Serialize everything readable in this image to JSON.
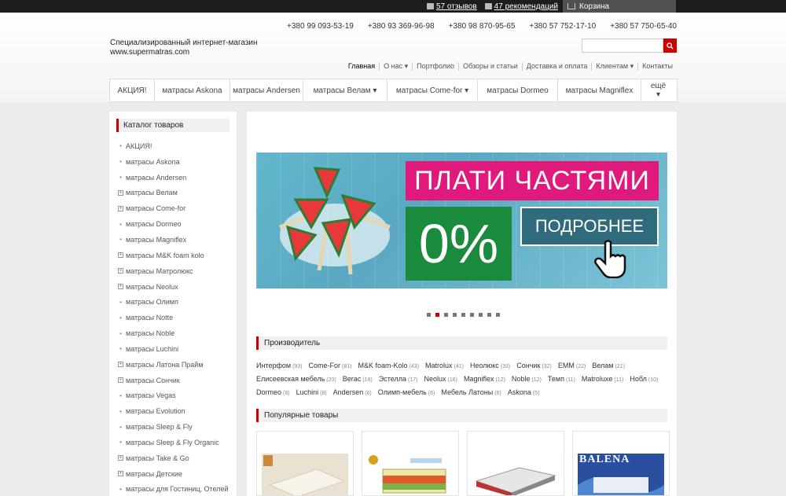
{
  "topbar": {
    "reviews": "57 отзывов",
    "recommendations": "47 рекомендаций",
    "cart": "Корзина"
  },
  "header": {
    "phones": [
      "+380 99 093-53-19",
      "+380 93 369-96-98",
      "+380 98 870-95-65",
      "+380 57 752-17-10",
      "+380 57 750-65-40"
    ],
    "tagline": "Специализированный интернет-магазин",
    "site": "www.supermatras.com",
    "search_placeholder": ""
  },
  "topnav": [
    "Главная",
    "О нас ▾",
    "Портфолио",
    "Обзоры и статьи",
    "Доставка и оплата",
    "Клиентам ▾",
    "Контакты"
  ],
  "mainmenu": [
    "АКЦИЯ!",
    "матрасы Askona",
    "матрасы Andersen",
    "матрасы Велам ▾",
    "матрасы Come-for ▾",
    "матрасы Dormeo",
    "матрасы Magniflex",
    "ещё",
    "▾"
  ],
  "sidebar": {
    "title": "Каталог товаров",
    "items": [
      {
        "label": "АКЦИЯ!",
        "plus": false
      },
      {
        "label": "матрасы Askona",
        "plus": false
      },
      {
        "label": "матрасы Andersen",
        "plus": false
      },
      {
        "label": "матрасы Велам",
        "plus": true
      },
      {
        "label": "матрасы Come-for",
        "plus": true
      },
      {
        "label": "матрасы Dormeo",
        "plus": false
      },
      {
        "label": "матрасы Magniflex",
        "plus": false
      },
      {
        "label": "матрасы M&K foam kolo",
        "plus": true
      },
      {
        "label": "матрасы Матролюкс",
        "plus": true
      },
      {
        "label": "матрасы Neolux",
        "plus": true
      },
      {
        "label": "матрасы Олимп",
        "plus": false
      },
      {
        "label": "матрасы Notte",
        "plus": false
      },
      {
        "label": "матрасы Noble",
        "plus": false
      },
      {
        "label": "матрасы Luchini",
        "plus": false
      },
      {
        "label": "матрасы Латона Прайм",
        "plus": true
      },
      {
        "label": "матрасы Сончик",
        "plus": true
      },
      {
        "label": "матрасы Vegas",
        "plus": false
      },
      {
        "label": "матрасы Evolution",
        "plus": false
      },
      {
        "label": "матрасы Sleep & Fly",
        "plus": false
      },
      {
        "label": "матрасы Sleep & Fly Organic",
        "plus": false
      },
      {
        "label": "матрасы Take & Go",
        "plus": true
      },
      {
        "label": "матрасы Детские",
        "plus": true
      },
      {
        "label": "матрасы для Гостиниц, Отелей",
        "plus": false
      }
    ]
  },
  "banner": {
    "headline": "ПЛАТИ ЧАСТЯМИ",
    "percent": "0%",
    "button": "ПОДРОБНЕЕ",
    "slides": 9,
    "active_slide": 2
  },
  "manufacturers": {
    "title": "Производитель",
    "rows": [
      [
        [
          "Интерфом",
          "(93)"
        ],
        [
          "Come-For",
          "(81)"
        ],
        [
          "M&K foam-Kolo",
          "(43)"
        ],
        [
          "Matrolux",
          "(41)"
        ],
        [
          "Неолюкс",
          "(33)"
        ],
        [
          "Сончик",
          "(32)"
        ],
        [
          "EMM",
          "(22)"
        ],
        [
          "Велам",
          "(21)"
        ]
      ],
      [
        [
          "Елисеевская мебель",
          "(20)"
        ],
        [
          "Вегас",
          "(18)"
        ],
        [
          "Эстелла",
          "(17)"
        ],
        [
          "Neolux",
          "(16)"
        ],
        [
          "Magniflex",
          "(12)"
        ],
        [
          "Noble",
          "(12)"
        ],
        [
          "Темп",
          "(11)"
        ],
        [
          "Matroluxe",
          "(11)"
        ],
        [
          "Нобл",
          "(10)"
        ]
      ],
      [
        [
          "Dormeo",
          "(8)"
        ],
        [
          "Luchini",
          "(8)"
        ],
        [
          "Andersen",
          "(6)"
        ],
        [
          "Олимп-мебель",
          "(6)"
        ],
        [
          "Мебель Латоны",
          "(6)"
        ],
        [
          "Askona",
          "(5)"
        ]
      ]
    ]
  },
  "popular": {
    "title": "Популярные товары",
    "logo_text": "BALENA"
  },
  "colors": {
    "accent": "#cc0000",
    "pink": "#e0197c",
    "green": "#1a8a3c",
    "banner_button": "#2f6b7c"
  }
}
